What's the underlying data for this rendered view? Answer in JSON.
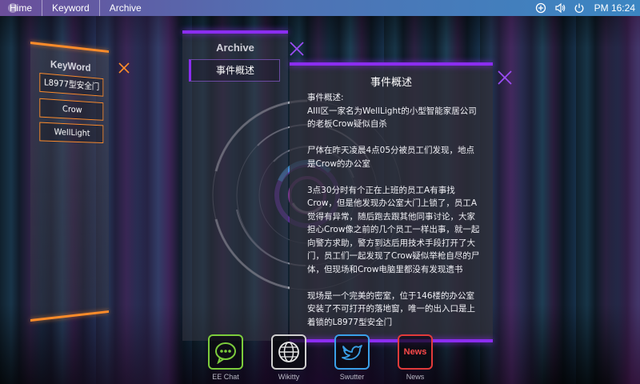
{
  "menubar": {
    "items": [
      "Hime",
      "Keyword",
      "Archive"
    ],
    "time": "PM 16:24",
    "icons": [
      "add-icon",
      "volume-icon",
      "power-icon"
    ]
  },
  "keyword_panel": {
    "title": "KeyWord",
    "items": [
      "L8977型安全门",
      "Crow",
      "WellLight"
    ],
    "accent": "#ff8c2a"
  },
  "archive_panel": {
    "title": "Archive",
    "items": [
      "事件概述"
    ],
    "accent": "#8b2df0"
  },
  "detail_panel": {
    "title": "事件概述",
    "heading": "事件概述:",
    "paragraphs": [
      "AIII区一家名为WellLight的小型智能家居公司的老板Crow疑似自杀",
      "尸体在昨天凌晨4点05分被员工们发现，地点是Crow的办公室",
      "3点30分时有个正在上班的员工A有事找Crow，但是他发现办公室大门上锁了，员工A觉得有异常，随后跑去跟其他同事讨论，大家担心Crow像之前的几个员工一样出事，就一起向警方求助，警方到达后用技术手段打开了大门，员工们一起发现了Crow疑似举枪自尽的尸体，但现场和Crow电脑里都没有发现遗书",
      "现场是一个完美的密室，位于146楼的办公室安装了不可打开的落地窗，唯一的出入口是上着锁的L8977型安全门"
    ]
  },
  "dock": {
    "apps": [
      {
        "label": "EE Chat",
        "icon": "chat-bubble-icon",
        "color": "#7ccc3c"
      },
      {
        "label": "Wikitty",
        "icon": "globe-icon",
        "color": "#cfcfcf"
      },
      {
        "label": "Swutter",
        "icon": "bird-icon",
        "color": "#3aa0e8"
      },
      {
        "label": "News",
        "icon_text": "News",
        "icon": "news-icon",
        "color": "#e23a3a"
      }
    ]
  }
}
